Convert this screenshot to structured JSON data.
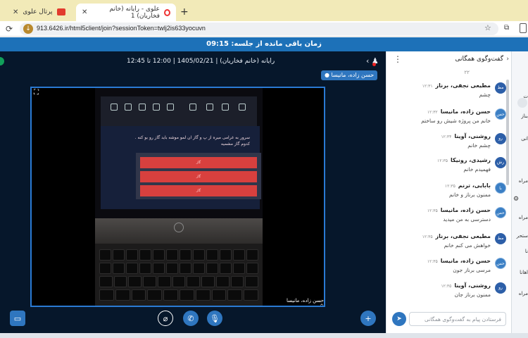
{
  "browser": {
    "tabs": [
      {
        "title": "پرتال علوی",
        "active": false
      },
      {
        "title": "علوی - رایانه (خانم فخاریان) 1",
        "active": true
      }
    ],
    "new_tab_symbol": "+",
    "close_symbol": "✕",
    "url": "913.6426.ir/html5client/join?sessionToken=twlj2is633yocuvn"
  },
  "session": {
    "timer_text": "زمان باقی مانده از جلسه: 09:15",
    "title": "رایانه (خانم فخاریان) | 1405/02/21 | 12:00 تا 12:45",
    "presenter_tag": "حسن زاده، مانیسا",
    "video_caption": "حسن زاده، مانیسا"
  },
  "slide": {
    "text": "سرور به غرامی میره از پ و گاز ان لمو موشه باید گاز رو بو کنه . کدوم گاز مشمیه"
  },
  "chat": {
    "title": "گفت‌وگوی همگانی",
    "partial_text": "۲۲",
    "composer_placeholder": "فرستادن پیام به گفت‌وگوی همگانی",
    "messages": [
      {
        "avatar": "مط",
        "name": "مطیعی نجفی، برناز",
        "time": "۱۲:۳۱",
        "text": "چشم"
      },
      {
        "avatar": "حس",
        "name": "حسن زاده، مانیسا",
        "time": "۱۲:۳۲",
        "text": "خانم من پروژه شیش رو ساختم"
      },
      {
        "avatar": "رو",
        "name": "روشنی، آوینا",
        "time": "۱۲:۳۴",
        "text": "چشم خانم"
      },
      {
        "avatar": "رش",
        "name": "رشیدی، رونیکا",
        "time": "۱۲:۳۵",
        "text": "فهمیدم خانم"
      },
      {
        "avatar": "با",
        "name": "بابایی، ترنم",
        "time": "۱۲:۳۵",
        "text": "ممنون برناز و خانم"
      },
      {
        "avatar": "حس",
        "name": "حسن زاده، مانیسا",
        "time": "۱۲:۳۵",
        "text": "دسترسی به من میدید"
      },
      {
        "avatar": "مط",
        "name": "مطیعی نجفی، برناز",
        "time": "۱۲:۳۵",
        "text": "خواهش می کنم خانم"
      },
      {
        "avatar": "حس",
        "name": "حسن زاده، مانیسا",
        "time": "۱۲:۳۵",
        "text": "مرسی برناز جون"
      },
      {
        "avatar": "رو",
        "name": "روشنی، آوینا",
        "time": "۱۲:۳۵",
        "text": "ممنون برناز جان"
      }
    ]
  },
  "sidebar_fragments": [
    "ت",
    "بناز",
    "انی",
    "مراه",
    "مراه",
    "ستحر",
    "نا",
    "اهانا",
    "مراه"
  ],
  "icons": {
    "reload": "reload-icon",
    "star": "bookmark-star-icon",
    "users": "users-icon",
    "expand": "expand-icon",
    "menu": "kebab-menu-icon",
    "send": "send-icon",
    "screen_share": "screen-share-icon",
    "camera_off": "camera-off-icon",
    "phone": "phone-icon",
    "mic": "microphone-icon",
    "plus": "plus-icon",
    "gear": "gear-icon"
  },
  "colors": {
    "timer_bar": "#1d71b8",
    "stage_bg": "#06172b",
    "accent": "#2f76bf",
    "tabbar": "#f2eab8"
  }
}
